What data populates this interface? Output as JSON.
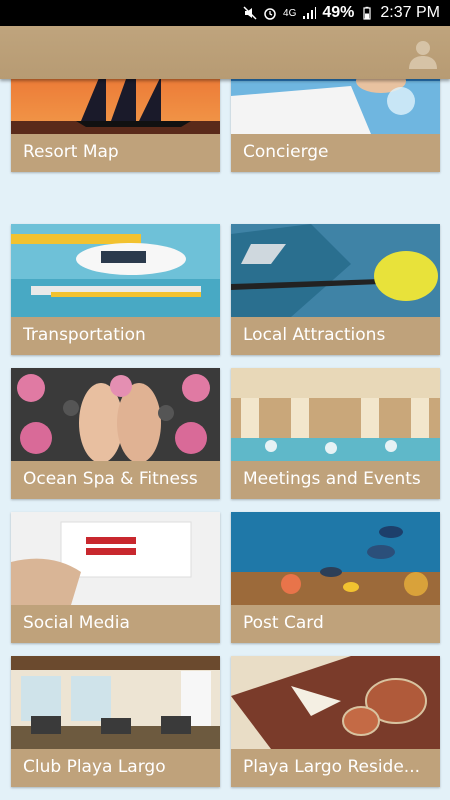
{
  "status_bar": {
    "network": "4G",
    "battery": "49%",
    "time": "2:37 PM"
  },
  "header": {
    "profile_icon": "user-silhouette-icon"
  },
  "tiles": [
    {
      "label": "Resort Map"
    },
    {
      "label": "Concierge"
    },
    {
      "label": "Transportation"
    },
    {
      "label": "Local Attractions"
    },
    {
      "label": "Ocean Spa & Fitness"
    },
    {
      "label": "Meetings and Events"
    },
    {
      "label": "Social Media"
    },
    {
      "label": "Post Card"
    },
    {
      "label": "Club Playa Largo"
    },
    {
      "label": "Playa Largo Reside..."
    }
  ],
  "colors": {
    "header": "#b79b73",
    "tile_caption": "#bfa27b",
    "background": "#e3f1f8"
  }
}
